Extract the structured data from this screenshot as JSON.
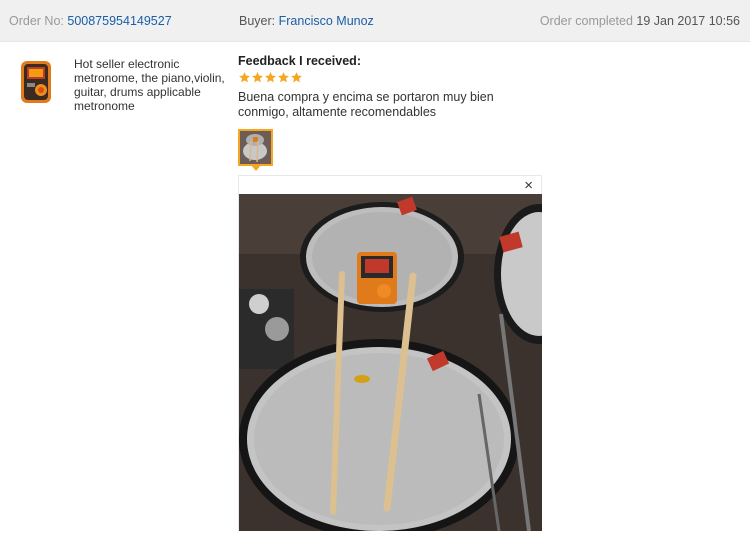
{
  "order": {
    "number_label": "Order No:",
    "number": "500875954149527",
    "buyer_label": "Buyer:",
    "buyer_name": "Francisco Munoz",
    "status_label": "Order completed",
    "status_date": "19 Jan 2017 10:56"
  },
  "product": {
    "title": "Hot seller electronic metronome, the piano,violin, guitar, drums applicable metronome",
    "thumb_icon": "metronome-product-image"
  },
  "feedback": {
    "heading": "Feedback I received:",
    "rating": 5,
    "rating_max": 5,
    "text": "Buena compra y encima se portaron muy bien conmigo, altamente recomendables"
  },
  "photo_viewer": {
    "close_label": "×",
    "image_icon": "drum-kit-photo"
  },
  "colors": {
    "link": "#1a5ea8",
    "star": "#f5a623",
    "header_bg": "#f0f0f0",
    "thumb_border": "#f5a623"
  }
}
